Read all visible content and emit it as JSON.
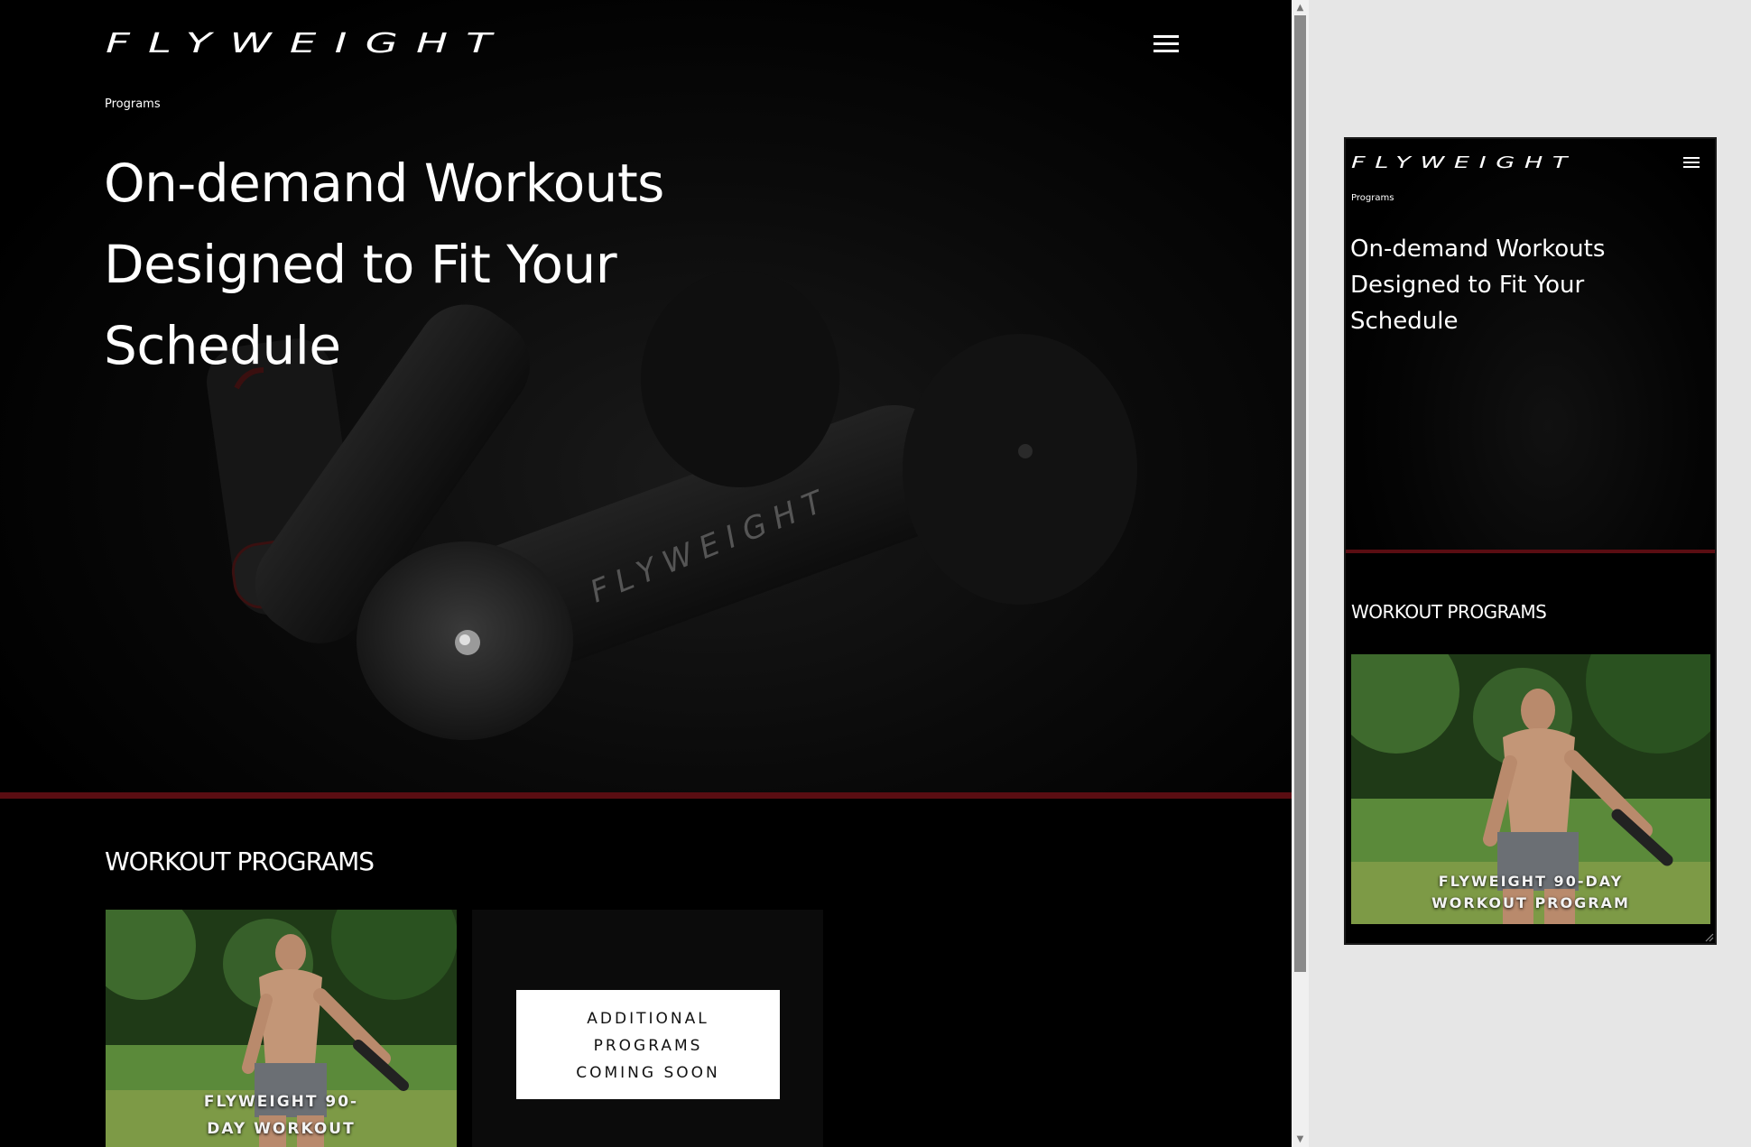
{
  "brand": {
    "logo_text": "FLYWEIGHT",
    "watermark_text": "FLYWEIGHT"
  },
  "nav": {
    "menu_icon": "hamburger-menu-icon"
  },
  "breadcrumb": {
    "label": "Programs"
  },
  "hero": {
    "headline_lines": [
      "On-demand Workouts",
      "Designed to Fit Your",
      "Schedule"
    ]
  },
  "workout_section": {
    "title": "WORKOUT PROGRAMS"
  },
  "cards": {
    "program_90_day": {
      "caption_lines": [
        "FLYWEIGHT 90-",
        "DAY WORKOUT"
      ]
    },
    "coming_soon": {
      "lines": [
        "ADDITIONAL",
        "PROGRAMS",
        "COMING SOON"
      ]
    }
  },
  "mobile": {
    "breadcrumb": "Programs",
    "headline_lines": [
      "On-demand Workouts",
      "Designed to Fit Your",
      "Schedule"
    ],
    "section_title": "WORKOUT PROGRAMS",
    "program_caption_lines": [
      "FLYWEIGHT 90-DAY",
      "WORKOUT PROGRAM"
    ]
  },
  "colors": {
    "accent_red": "#5a0d12",
    "background": "#000000",
    "text": "#ffffff"
  }
}
